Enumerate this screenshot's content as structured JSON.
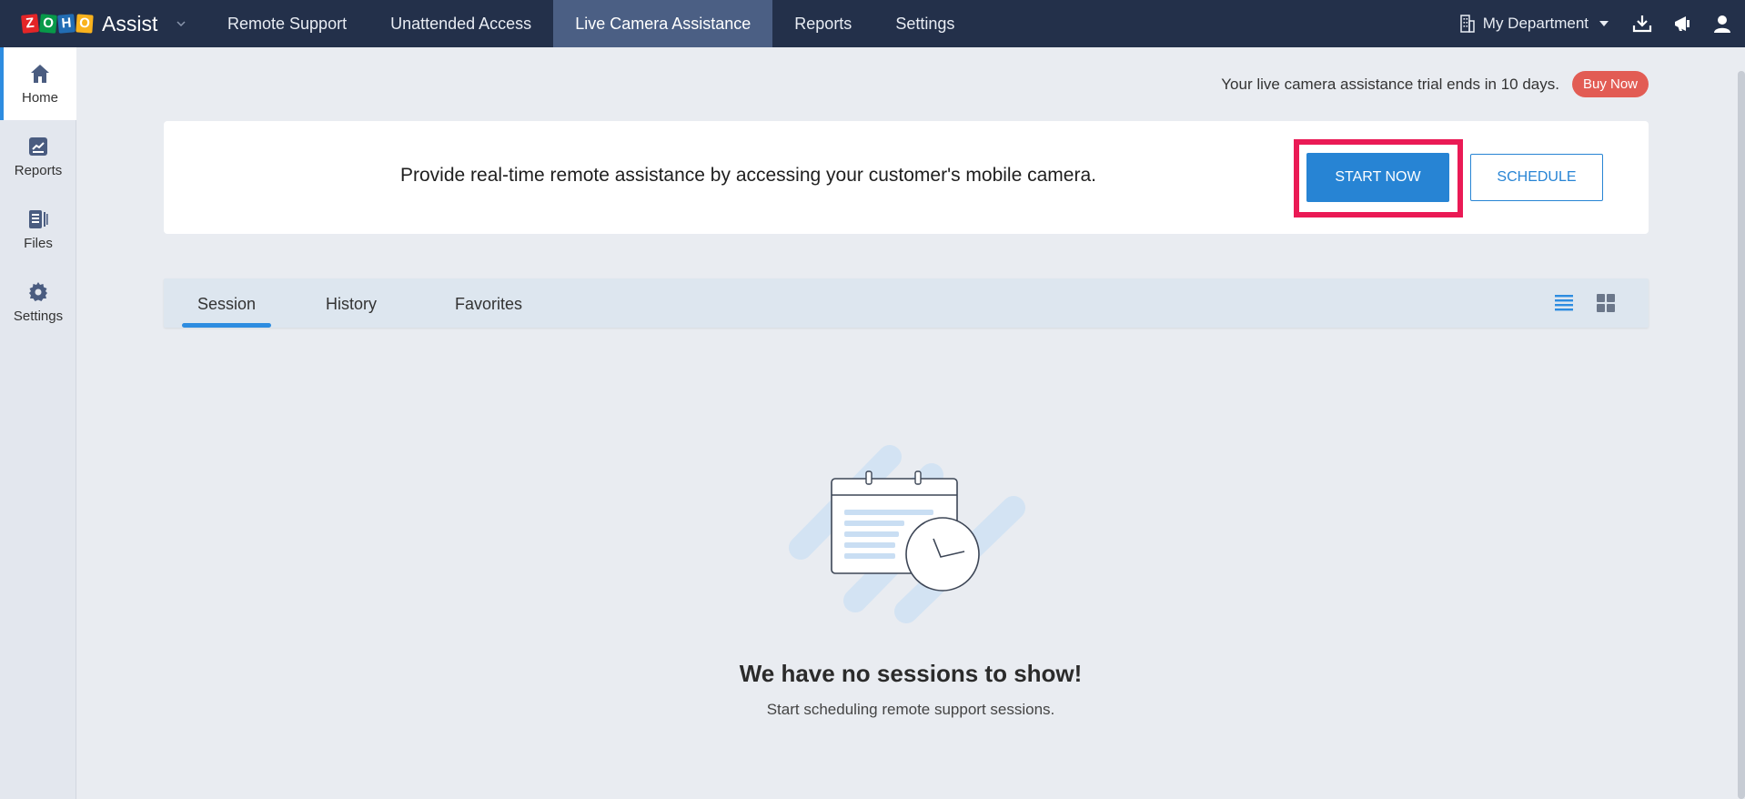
{
  "topbar": {
    "logo_letters": [
      "Z",
      "O",
      "H",
      "O"
    ],
    "app_name": "Assist",
    "nav": [
      {
        "label": "Remote Support"
      },
      {
        "label": "Unattended Access"
      },
      {
        "label": "Live Camera Assistance"
      },
      {
        "label": "Reports"
      },
      {
        "label": "Settings"
      }
    ],
    "active_nav": "Live Camera Assistance",
    "department": "My Department",
    "icons": [
      "building-icon",
      "download-icon",
      "announcement-icon",
      "user-icon"
    ]
  },
  "sidebar": {
    "items": [
      {
        "label": "Home",
        "icon": "home-icon"
      },
      {
        "label": "Reports",
        "icon": "reports-icon"
      },
      {
        "label": "Files",
        "icon": "files-icon"
      },
      {
        "label": "Settings",
        "icon": "gear-icon"
      }
    ],
    "active": "Home"
  },
  "trial": {
    "text": "Your live camera assistance trial ends in 10 days.",
    "buy_label": "Buy Now"
  },
  "promo": {
    "text": "Provide real-time remote assistance by accessing your customer's mobile camera.",
    "start_label": "START NOW",
    "schedule_label": "SCHEDULE"
  },
  "tabs": {
    "items": [
      {
        "label": "Session"
      },
      {
        "label": "History"
      },
      {
        "label": "Favorites"
      }
    ],
    "active": "Session",
    "view_icons": [
      "list-view-icon",
      "grid-view-icon"
    ]
  },
  "empty": {
    "title": "We have no sessions to show!",
    "subtitle": "Start scheduling remote support sessions."
  },
  "colors": {
    "topbar": "#23304a",
    "active_nav": "#4b5f84",
    "accent": "#2784d4",
    "highlight": "#ea1a55",
    "buy_now": "#e25c54"
  }
}
